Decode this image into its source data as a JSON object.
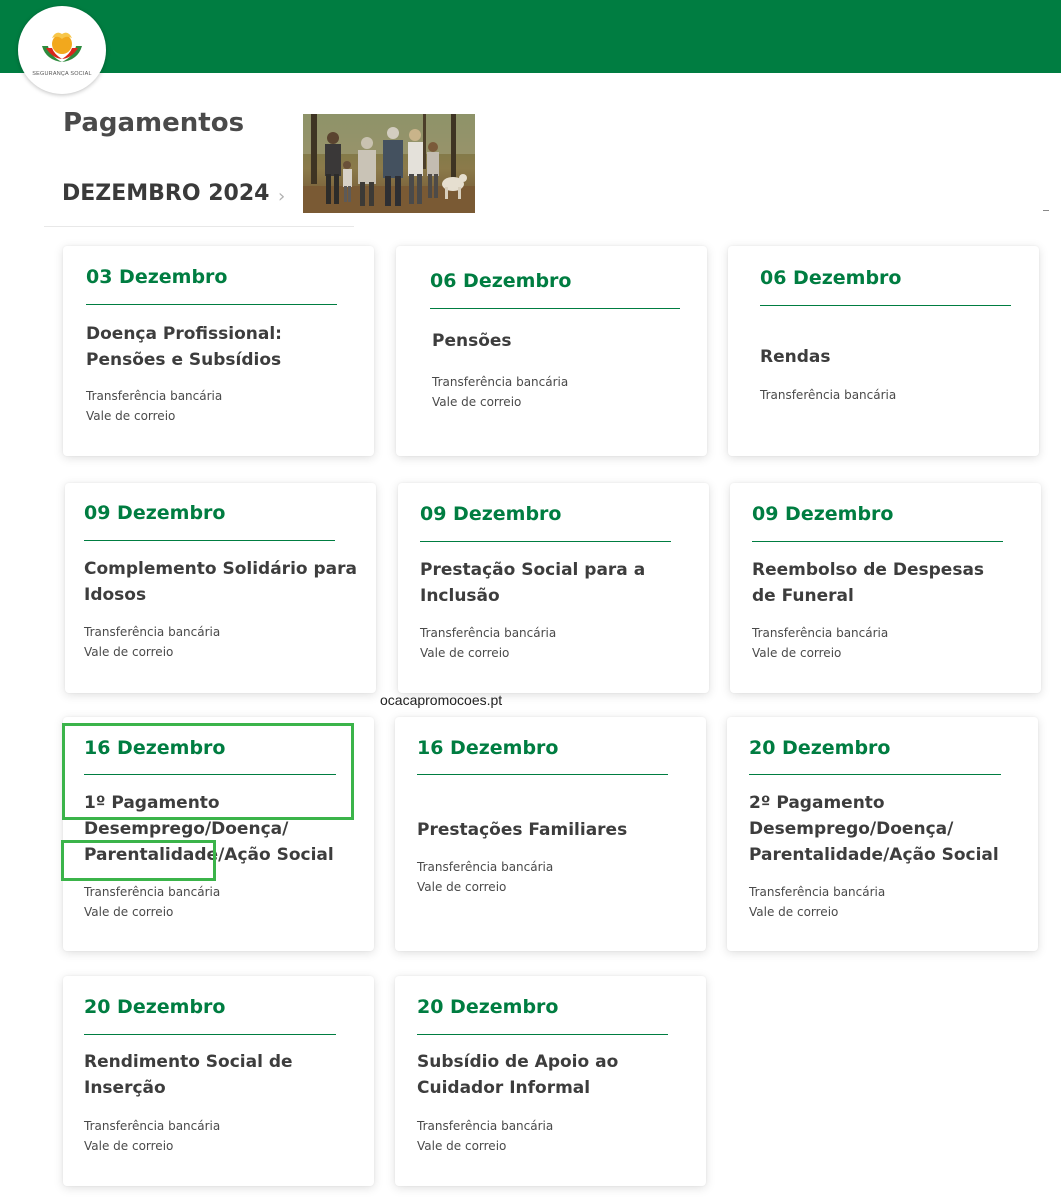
{
  "header": {
    "logo_text": "SEGURANÇA SOCIAL",
    "brand_color": "#007d41"
  },
  "page": {
    "title": "Pagamentos",
    "month": "DEZEMBRO 2024",
    "chevron": "›"
  },
  "cards": [
    {
      "date": "03 Dezembro",
      "title": "Doença Profissional: Pensões e Subsídios",
      "methods": [
        "Transferência bancária",
        "Vale de correio"
      ]
    },
    {
      "date": "06 Dezembro",
      "title": "Pensões",
      "methods": [
        "Transferência bancária",
        "Vale de correio"
      ]
    },
    {
      "date": "06 Dezembro",
      "title": "Rendas",
      "methods": [
        "Transferência bancária"
      ]
    },
    {
      "date": "09 Dezembro",
      "title": "Complemento Solidário para Idosos",
      "methods": [
        "Transferência bancária",
        "Vale de correio"
      ]
    },
    {
      "date": "09 Dezembro",
      "title": "Prestação Social para a Inclusão",
      "methods": [
        "Transferência bancária",
        "Vale de correio"
      ]
    },
    {
      "date": "09 Dezembro",
      "title": "Reembolso de Despesas de Funeral",
      "methods": [
        "Transferência bancária",
        "Vale de correio"
      ]
    },
    {
      "date": "16 Dezembro",
      "title": "1º Pagamento Desemprego/Doença/ Parentalidade/Ação Social",
      "methods": [
        "Transferência bancária",
        "Vale de correio"
      ]
    },
    {
      "date": "16 Dezembro",
      "title": "Prestações Familiares",
      "methods": [
        "Transferência bancária",
        "Vale de correio"
      ]
    },
    {
      "date": "20 Dezembro",
      "title": "2º Pagamento Desemprego/Doença/ Parentalidade/Ação Social",
      "methods": [
        "Transferência bancária",
        "Vale de correio"
      ]
    },
    {
      "date": "20 Dezembro",
      "title": "Rendimento Social de Inserção",
      "methods": [
        "Transferência bancária",
        "Vale de correio"
      ]
    },
    {
      "date": "20 Dezembro",
      "title": "Subsídio de Apoio ao Cuidador Informal",
      "methods": [
        "Transferência bancária",
        "Vale de correio"
      ]
    }
  ],
  "watermark": "ocacapromocoes.pt"
}
